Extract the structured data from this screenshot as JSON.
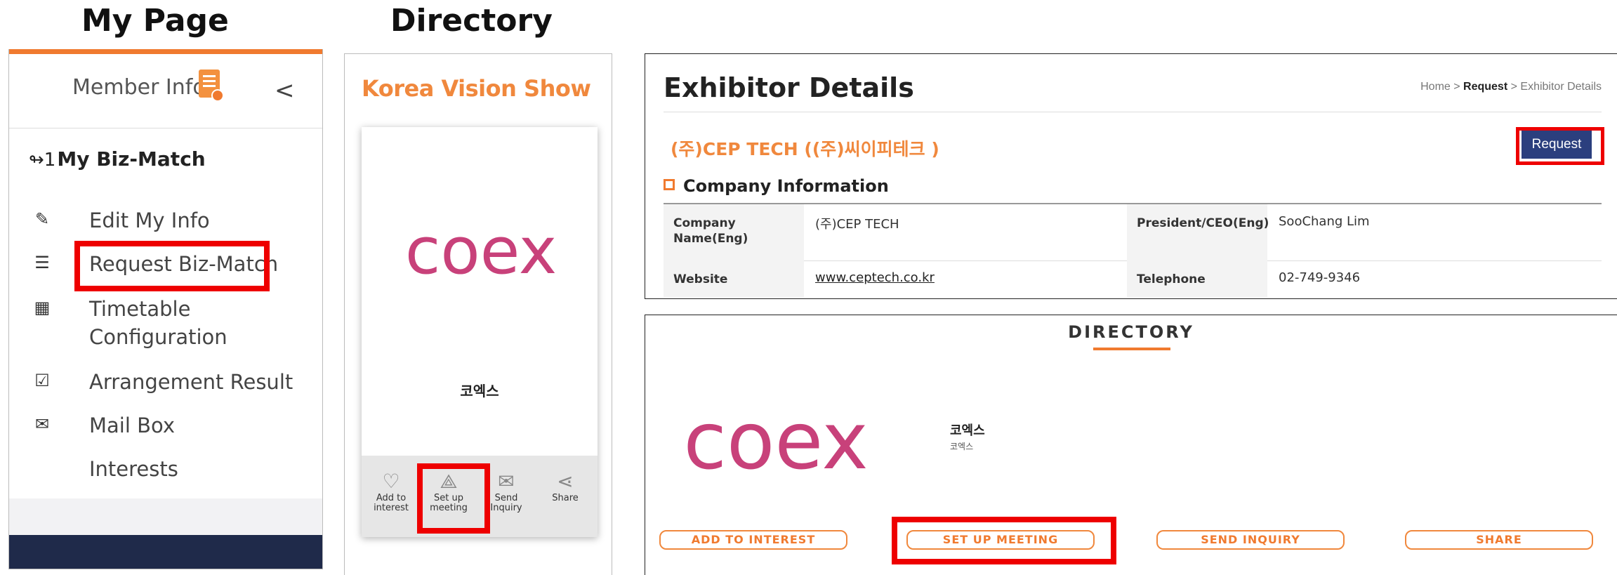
{
  "headings": {
    "my_page": "My Page",
    "directory": "Directory"
  },
  "my_page": {
    "member_info": "Member Info",
    "collapse_glyph": "<",
    "biz_match_icon": "↬1",
    "biz_match_title": "My Biz-Match",
    "menu": [
      {
        "icon": "✎",
        "label": "Edit My Info"
      },
      {
        "icon": "☰",
        "label": "Request Biz-Match"
      },
      {
        "icon": "▦",
        "label": "Timetable",
        "label2": "Configuration"
      },
      {
        "icon": "☑",
        "label": "Arrangement Result"
      },
      {
        "icon": "✉",
        "label": "Mail Box"
      },
      {
        "icon": "",
        "label": "Interests"
      }
    ]
  },
  "directory_mobile": {
    "show_title": "Korea Vision Show",
    "logo_text": "coex",
    "company_name": "코엑스",
    "actions": [
      {
        "icon": "♡",
        "label": "Add to interest"
      },
      {
        "icon": "⟁",
        "label": "Set up meeting"
      },
      {
        "icon": "✉",
        "label": "Send Inquiry"
      },
      {
        "icon": "⋖",
        "label": "Share"
      }
    ]
  },
  "exhibitor": {
    "title": "Exhibitor Details",
    "breadcrumb": {
      "home": "Home",
      "sep": " > ",
      "request": "Request",
      "current": "Exhibitor Details"
    },
    "company_heading": "(주)CEP TECH ((주)씨이피테크 )",
    "request_button": "Request",
    "section_title": "Company Information",
    "fields": {
      "company_name_label": "Company Name(Eng)",
      "company_name_value": "(주)CEP TECH",
      "president_label": "President/CEO(Eng)",
      "president_value": "SooChang Lim",
      "website_label": "Website",
      "website_value": "www.ceptech.co.kr",
      "telephone_label": "Telephone",
      "telephone_value": "02-749-9346"
    }
  },
  "directory_desktop": {
    "title": "DIRECTORY",
    "logo_text": "coex",
    "company_name": "코엑스",
    "company_sub": "코엑스",
    "buttons": [
      "ADD TO INTEREST",
      "SET UP MEETING",
      "SEND INQUIRY",
      "SHARE"
    ]
  },
  "colors": {
    "accent": "#f07a2f",
    "brand_blue": "#2b3f7e",
    "coex_pink": "#c8417a",
    "highlight": "#ee0000",
    "dark_bar": "#1f2a4a"
  }
}
